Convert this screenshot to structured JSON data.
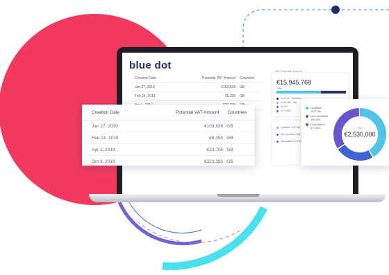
{
  "app": {
    "logo_text": "blue dot"
  },
  "colors": {
    "accent_pink": "#f23a5f",
    "accent_cyan": "#4be0ee",
    "brand_navy": "#253165",
    "donut_cyan": "#4fc3ea",
    "donut_blue": "#3f62d6",
    "donut_purple": "#6a55cf"
  },
  "mini_table": {
    "headers": [
      "Creation Date",
      "Potential VAT Amount",
      "Countries"
    ],
    "rows": [
      [
        "Jan 27, 2019",
        "€103,638",
        "GB"
      ],
      [
        "Feb 24, 2019",
        "€6,255",
        "GB"
      ],
      [
        "Apr 1, 2019",
        "€23,705",
        "GB"
      ]
    ]
  },
  "right_panel": {
    "title": "VAT Potential Refund",
    "amount": "€15,945,768",
    "bar_label": "Total",
    "bar_fill_fraction": 0.64,
    "legend": [
      "€13,134 · Qualified",
      "€108,084 · Not",
      "€3,427",
      "€174,900"
    ]
  },
  "small_card": {
    "legend": [
      "Qualified 1427 file",
      "Non Qualified 186,000",
      "Disqualified 870,920"
    ]
  },
  "card_table": {
    "headers": [
      "Creation Date",
      "Potential VAT Amount",
      "Countries"
    ],
    "rows": [
      [
        "Jan 27, 2019",
        "€103,638",
        "GB"
      ],
      [
        "Feb 24, 2019",
        "€6,255",
        "GB"
      ],
      [
        "Apr 1, 2019",
        "€23,705",
        "GB"
      ],
      [
        "Oct 3, 2019",
        "€323,395",
        "GB"
      ]
    ]
  },
  "donut_card": {
    "legend": [
      {
        "label": "Qualified",
        "sub": "1427 file",
        "color": "#4fc3ea"
      },
      {
        "label": "New Qualified",
        "sub": "186,000",
        "color": "#3f62d6"
      },
      {
        "label": "Disqualified",
        "sub": "870,920",
        "color": "#6a55cf"
      }
    ],
    "center_label": "Total",
    "total": "€2,530,000",
    "segments": [
      0.42,
      0.24,
      0.34
    ]
  }
}
